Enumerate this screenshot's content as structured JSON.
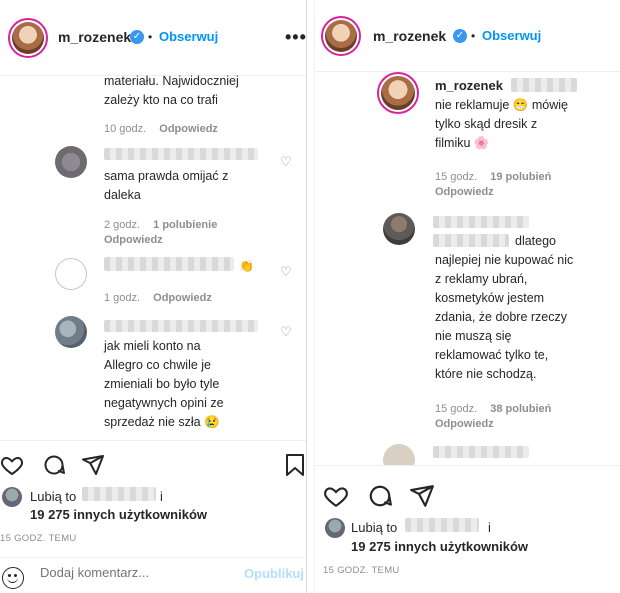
{
  "left": {
    "header": {
      "username": "m_rozenek",
      "separator": "•",
      "follow": "Obserwuj",
      "more": "•••"
    },
    "comments": [
      {
        "text_lines": [
          "materiału. Najwidoczniej",
          "zależy kto na co trafi"
        ],
        "time": "10 godz.",
        "reply": "Odpowiedz"
      },
      {
        "text_lines": [
          "sama prawda omijać z",
          "daleka"
        ],
        "time": "2 godz.",
        "likes": "1 polubienie",
        "reply": "Odpowiedz"
      },
      {
        "text_lines": [],
        "time": "1 godz.",
        "reply": "Odpowiedz"
      },
      {
        "text_lines": [
          "jak mieli konto na",
          "Allegro co chwile je",
          "zmieniali bo było tyle",
          "negatywnych opini ze",
          "sprzedaż nie szła 😢"
        ]
      }
    ],
    "likes": {
      "prefix": "Lubią to",
      "suffix": "i",
      "count": "19 275 innych użytkowników"
    },
    "posted": "15 GODZ. TEMU",
    "add_comment": {
      "placeholder": "Dodaj komentarz...",
      "publish": "Opublikuj"
    }
  },
  "right": {
    "header": {
      "username": "m_rozenek",
      "separator": "•",
      "follow": "Obserwuj"
    },
    "comments": [
      {
        "author": "m_rozenek",
        "text_lines": [
          "nie reklamuje 😁 mówię",
          "tylko skąd dresik z",
          "filmiku 🌸"
        ],
        "time": "15 godz.",
        "likes": "19 polubień",
        "reply": "Odpowiedz"
      },
      {
        "text_lines": [
          "dlatego",
          "najlepiej nie kupować nic",
          "z reklamy ubrań,",
          "kosmetyków jestem",
          "zdania, że dobre rzeczy",
          "nie muszą się",
          "reklamować tylko te,",
          "które nie schodzą."
        ],
        "time": "15 godz.",
        "likes": "38 polubień",
        "reply": "Odpowiedz"
      }
    ],
    "likes": {
      "prefix": "Lubią to",
      "suffix": "i",
      "count": "19 275 innych użytkowników"
    },
    "posted": "15 GODZ. TEMU"
  }
}
